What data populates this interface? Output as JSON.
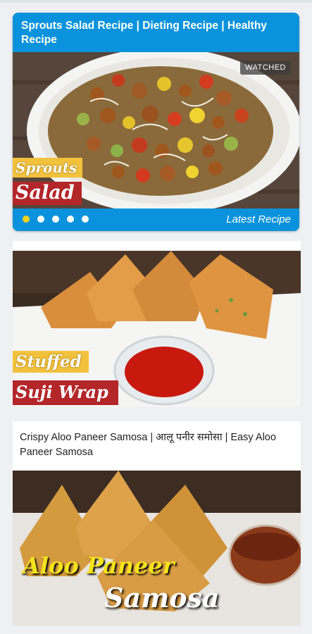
{
  "featured": {
    "title": "Sprouts Salad Recipe | Dieting Recipe | Healthy Recipe",
    "badge": "WATCHED",
    "overlay_line1": "Sprouts",
    "overlay_line2": "Salad",
    "footer_label": "Latest Recipe",
    "slides": {
      "count": 5,
      "active_index": 0
    },
    "colors": {
      "accent": "#0a93dc",
      "dot_active": "#f2d21b"
    }
  },
  "card2": {
    "overlay_line1": "Stuffed",
    "overlay_line2": "Suji Wrap"
  },
  "card3": {
    "title": "Crispy Aloo Paneer Samosa | आलू पनीर समोसा | Easy Aloo Paneer Samosa",
    "overlay_line1": "Aloo Paneer",
    "overlay_line2": "Samosa"
  }
}
